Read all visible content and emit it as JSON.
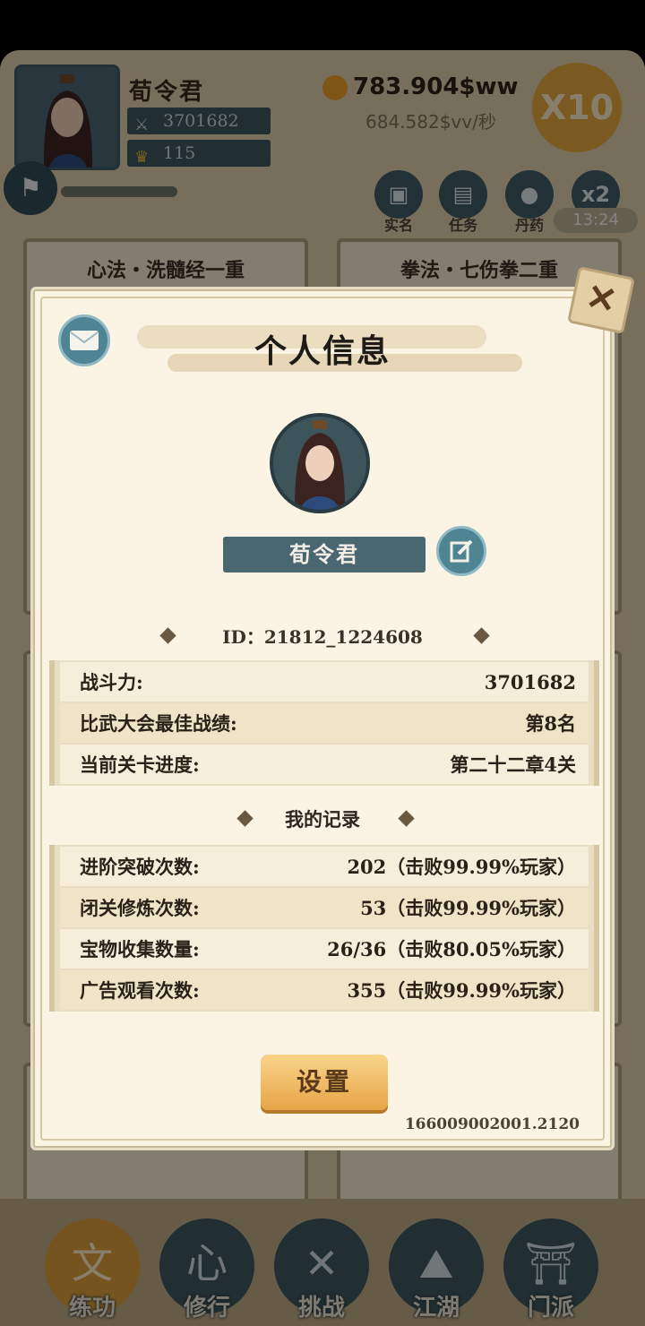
{
  "header": {
    "player_name": "荀令君",
    "combat_power": "3701682",
    "gold_ingots": "115",
    "currency": "783.904$ww",
    "rate": "684.582$vv/秒",
    "speed_multiplier": "X10",
    "quick_buttons": [
      {
        "label": "实名",
        "icon": "id-card-icon"
      },
      {
        "label": "任务",
        "icon": "scroll-icon"
      },
      {
        "label": "丹药",
        "icon": "pill-icon"
      },
      {
        "label": "x2",
        "icon": "double-icon"
      }
    ],
    "timer": "13:24"
  },
  "cards": [
    {
      "title": "心法・洗髓经一重"
    },
    {
      "title": "拳法・七伤拳二重"
    }
  ],
  "bottom_nav": [
    {
      "label": "练功",
      "glyph": "文",
      "active": true
    },
    {
      "label": "修行",
      "glyph": "心",
      "active": false
    },
    {
      "label": "挑战",
      "glyph": "✕",
      "active": false
    },
    {
      "label": "江湖",
      "glyph": "⛰",
      "active": false
    },
    {
      "label": "门派",
      "glyph": "⛩",
      "active": false
    }
  ],
  "modal": {
    "title": "个人信息",
    "name": "荀令君",
    "id_line": "ID：21812_1224608",
    "stats": [
      {
        "label": "战斗力:",
        "value": "3701682"
      },
      {
        "label": "比武大会最佳战绩:",
        "value": "第8名"
      },
      {
        "label": "当前关卡进度:",
        "value": "第二十二章4关"
      }
    ],
    "records_title": "我的记录",
    "records": [
      {
        "label": "进阶突破次数:",
        "value": "202（击败99.99%玩家）"
      },
      {
        "label": "闭关修炼次数:",
        "value": "53（击败99.99%玩家）"
      },
      {
        "label": "宝物收集数量:",
        "value": "26/36（击败80.05%玩家）"
      },
      {
        "label": "广告观看次数:",
        "value": "355（击败99.99%玩家）"
      }
    ],
    "settings_label": "设置",
    "version": "166009002001.2120"
  }
}
